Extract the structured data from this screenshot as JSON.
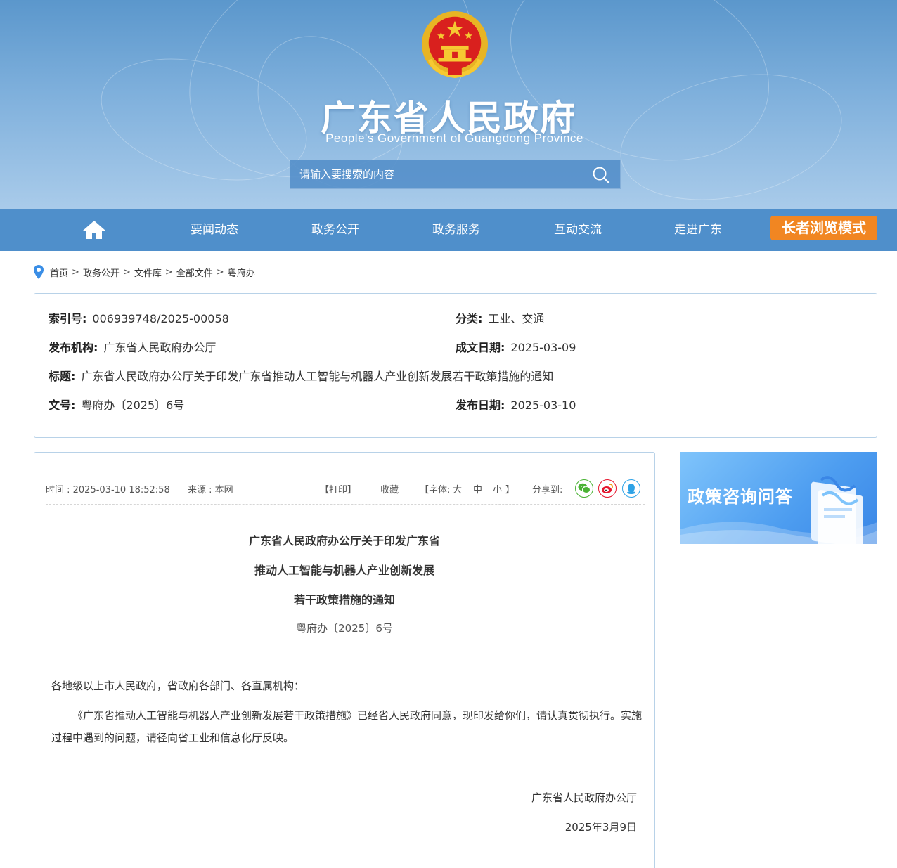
{
  "header": {
    "site_title": "广东省人民政府",
    "site_subtitle": "People's Government of Guangdong Province",
    "search_placeholder": "请输入要搜索的内容"
  },
  "nav": {
    "items": [
      "要闻动态",
      "政务公开",
      "政务服务",
      "互动交流",
      "走进广东"
    ],
    "elder_mode": "长者浏览模式"
  },
  "breadcrumb": [
    "首页",
    "政务公开",
    "文件库",
    "全部文件",
    "粤府办"
  ],
  "meta": {
    "index_label": "索引号:",
    "index_value": "006939748/2025-00058",
    "category_label": "分类:",
    "category_value": "工业、交通",
    "publisher_label": "发布机构:",
    "publisher_value": "广东省人民政府办公厅",
    "written_date_label": "成文日期:",
    "written_date_value": "2025-03-09",
    "title_label": "标题:",
    "title_value": "广东省人民政府办公厅关于印发广东省推动人工智能与机器人产业创新发展若干政策措施的通知",
    "doc_no_label": "文号:",
    "doc_no_value": "粤府办〔2025〕6号",
    "publish_date_label": "发布日期:",
    "publish_date_value": "2025-03-10"
  },
  "article": {
    "time": "时间 : 2025-03-10 18:52:58",
    "source": "来源 : 本网",
    "print": "【打印】",
    "favorite": "收藏",
    "font_prefix": "【字体:",
    "font_large": "大",
    "font_medium": "中",
    "font_small": "小",
    "font_suffix": "】",
    "share_label": "分享到:",
    "title_lines": [
      "广东省人民政府办公厅关于印发广东省",
      "推动人工智能与机器人产业创新发展",
      "若干政策措施的通知"
    ],
    "doc_number": "粤府办〔2025〕6号",
    "salutation": "各地级以上市人民政府，省政府各部门、各直属机构：",
    "body": "《广东省推动人工智能与机器人产业创新发展若干政策措施》已经省人民政府同意，现印发给你们，请认真贯彻执行。实施过程中遇到的问题，请径向省工业和信息化厅反映。",
    "signature": "广东省人民政府办公厅",
    "date": "2025年3月9日"
  },
  "banner": {
    "text": "政策咨询问答"
  },
  "colors": {
    "nav_bg": "#4f8fcb",
    "elder_btn": "#f18622",
    "border": "#b8d2e8"
  }
}
